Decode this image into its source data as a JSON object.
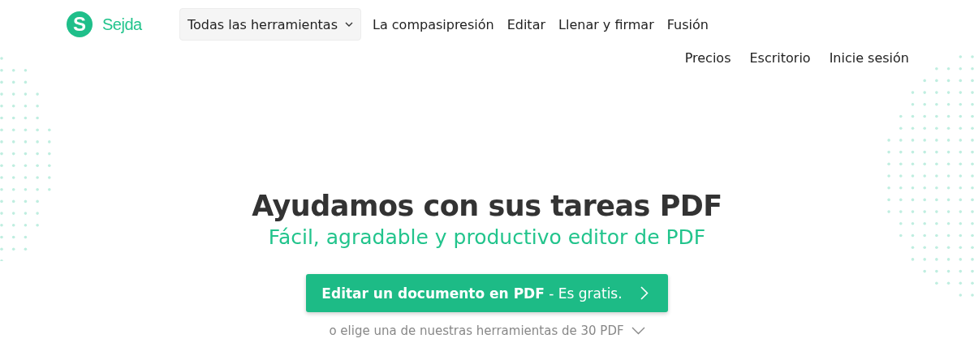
{
  "header": {
    "logo_letter": "S",
    "brand": "Sejda",
    "tools_dropdown": "Todas las herramientas",
    "nav": [
      "La compasipresión",
      "Editar",
      "Llenar y firmar",
      "Fusión"
    ],
    "nav_secondary": [
      "Precios",
      "Escritorio",
      "Inicie sesión"
    ]
  },
  "hero": {
    "title": "Ayudamos con sus tareas PDF",
    "subtitle": "Fácil, agradable y productivo editor de PDF",
    "cta_button": "**Editar un documento en PDF** - Es gratis.",
    "tools_link": "o elige una de nuestras herramientas de 30 PDF"
  }
}
